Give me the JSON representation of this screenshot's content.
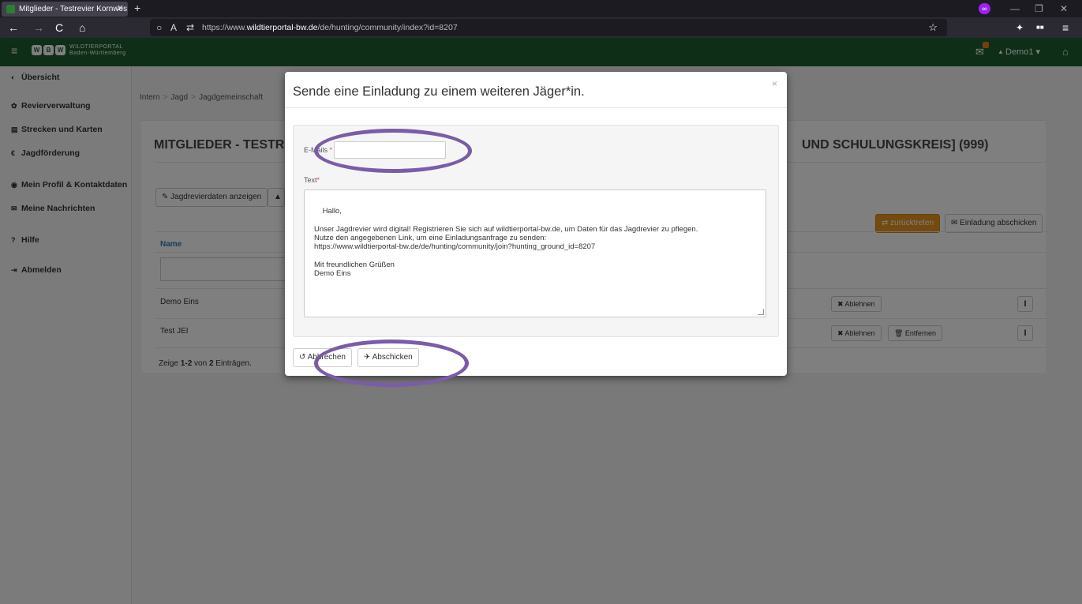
{
  "browser": {
    "tab_title": "Mitglieder - Testrevier Kornwes",
    "tab_close": "✕",
    "new_tab": "+",
    "url_prefix": "https://www.",
    "url_domain": "wildtierportal-bw.de",
    "url_path": "/de/hunting/community/index?id=8207",
    "back": "←",
    "forward": "→",
    "reload": "C",
    "home": "⌂",
    "shield": "○",
    "lock": "A",
    "perm": "⇄",
    "star": "☆",
    "ext_mask": "∞",
    "win_min": "—",
    "win_max": "❐",
    "win_close": "✕",
    "ext1": "✦",
    "ext2": "■■",
    "menu": "≡"
  },
  "app": {
    "menu_icon": "≡",
    "logo_glyphs": [
      "W",
      "B",
      "W"
    ],
    "logo_line1": "WILDTIERPORTAL",
    "logo_line2": "Baden-Württemberg",
    "user": "Demo1",
    "user_caret": "▾",
    "mail_icon": "✉",
    "home_icon": "⌂",
    "user_icon": "▲"
  },
  "sidebar": [
    {
      "icon": "◐",
      "label": "Übersicht"
    },
    {
      "icon": "✿",
      "label": "Revierverwaltung"
    },
    {
      "icon": "▤",
      "label": "Strecken und Karten"
    },
    {
      "icon": "€",
      "label": "Jagdförderung"
    },
    {
      "icon": "◉",
      "label": "Mein Profil & Kontaktdaten"
    },
    {
      "icon": "✉",
      "label": "Meine Nachrichten"
    },
    {
      "icon": "?",
      "label": "Hilfe"
    },
    {
      "icon": "⇥",
      "label": "Abmelden"
    }
  ],
  "breadcrumb": [
    "Intern",
    "Jagd",
    "Jagdgemeinschaft"
  ],
  "breadcrumb_sep": ">",
  "page": {
    "title_left": "MITGLIEDER - TESTREV",
    "title_right": "UND SCHULUNGSKREIS] (999)",
    "btn_jagd": "✎ Jagdrevierdaten anzeigen",
    "btn_chart": "▲",
    "btn_zurueck": "⇄ zurücktreten",
    "btn_einladung": "✉ Einladung abschicken",
    "col_name": "Name",
    "rows": [
      {
        "name": "Demo Eins",
        "btn1": "✖ Ablehnen",
        "btn2": "",
        "btn3": "I"
      },
      {
        "name": "Test JEI",
        "btn1": "✖ Ablehnen",
        "btn2": "🗑 Entfernen",
        "btn3": "I"
      }
    ],
    "footer_pre": "Zeige ",
    "footer_range": "1-2",
    "footer_mid": " von ",
    "footer_total": "2",
    "footer_post": " Einträgen."
  },
  "modal": {
    "title": "Sende eine Einladung zu einem weiteren Jäger*in.",
    "close": "×",
    "email_label": "E-Mails",
    "text_label": "Text",
    "required": "*",
    "text_value": "Hallo,\n\nUnser Jagdrevier wird digital! Registrieren Sie sich auf wildtierportal-bw.de, um Daten für das Jagdrevier zu pflegen.\nNutze den angegebenen Link, um eine Einladungsanfrage zu senden:\nhttps://www.wildtierportal-bw.de/de/hunting/community/join?hunting_ground_id=8207\n\nMit freundlichen Grüßen\nDemo Eins",
    "cancel": "↺ Abbrechen",
    "submit": "✈ Abschicken"
  },
  "colors": {
    "brand_green": "#1d5c2e",
    "accent_orange": "#e69520",
    "annotation_ring": "#7b5ca7"
  }
}
